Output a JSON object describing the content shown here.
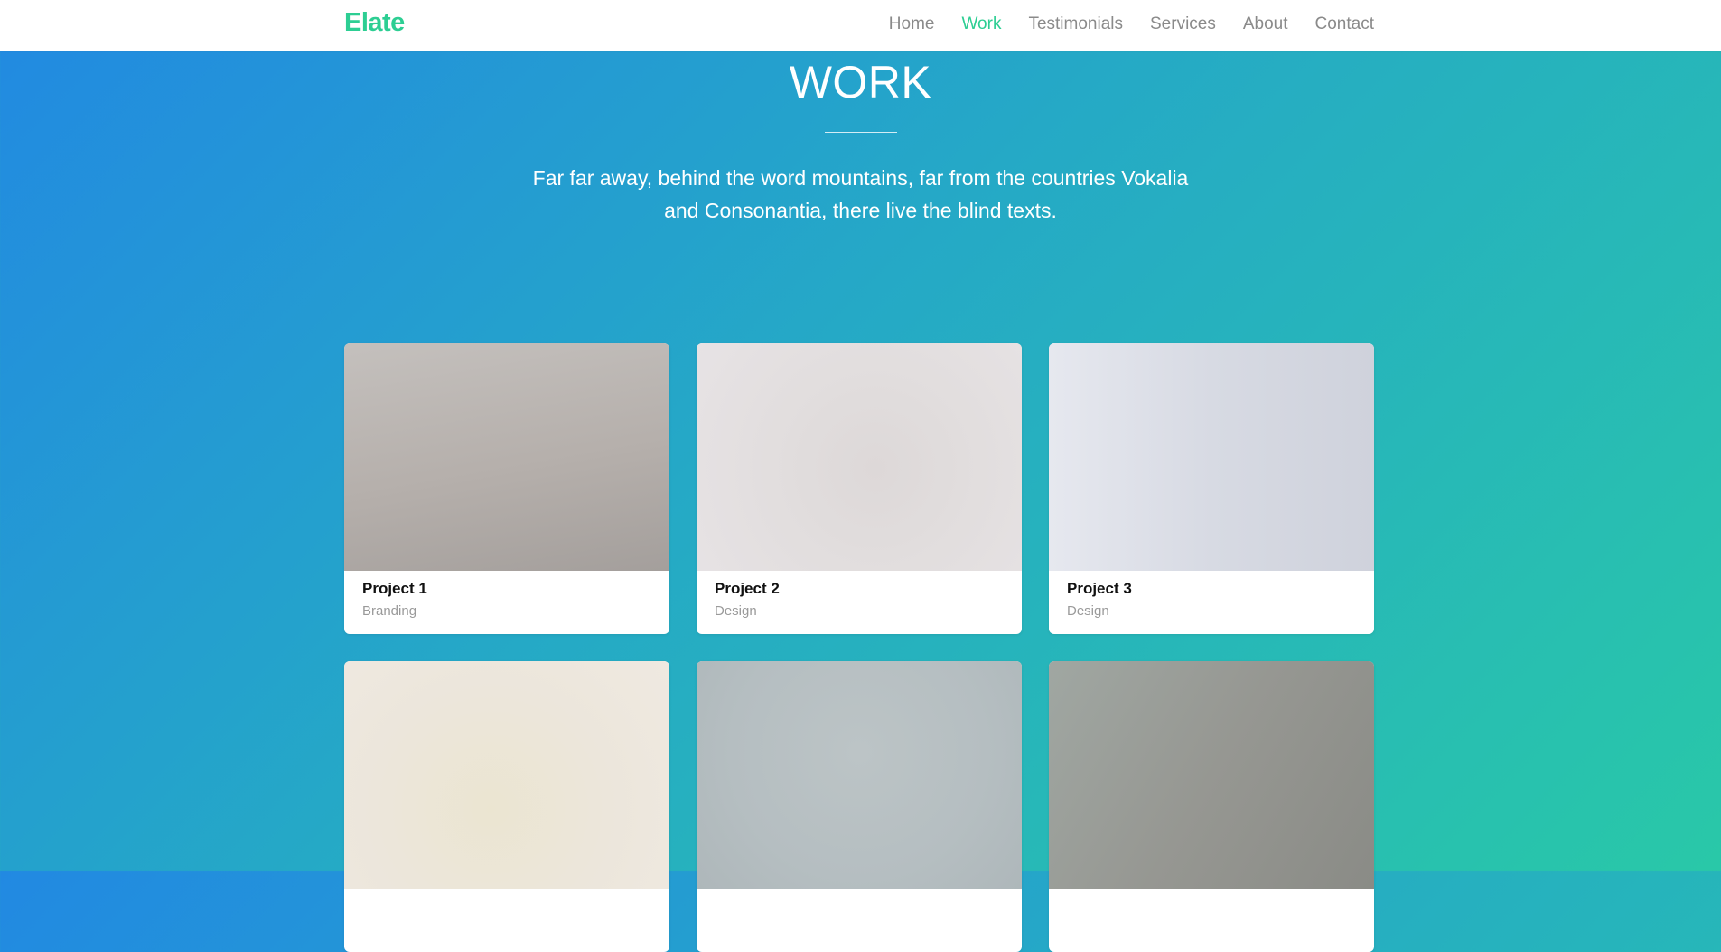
{
  "brand": {
    "name": "Elate",
    "color": "#2dce93"
  },
  "nav": {
    "items": [
      {
        "label": "Home",
        "active": false
      },
      {
        "label": "Work",
        "active": true
      },
      {
        "label": "Testimonials",
        "active": false
      },
      {
        "label": "Services",
        "active": false
      },
      {
        "label": "About",
        "active": false
      },
      {
        "label": "Contact",
        "active": false
      }
    ]
  },
  "hero": {
    "title": "WORK",
    "description": "Far far away, behind the word mountains, far from the countries Vokalia and Consonantia, there live the blind texts."
  },
  "projects": [
    {
      "title": "Project 1",
      "category": "Branding"
    },
    {
      "title": "Project 2",
      "category": "Design"
    },
    {
      "title": "Project 3",
      "category": "Design"
    },
    {
      "title": "",
      "category": ""
    },
    {
      "title": "",
      "category": ""
    },
    {
      "title": "",
      "category": ""
    }
  ],
  "colors": {
    "gradient_start": "#2289e2",
    "gradient_end": "#29c8a8",
    "nav_text": "#8a8a8a",
    "accent": "#2dce93"
  }
}
